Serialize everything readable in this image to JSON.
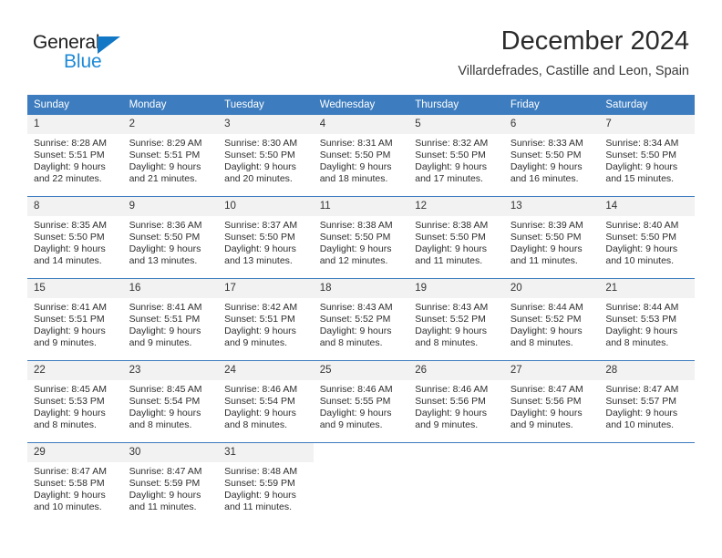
{
  "brand": {
    "name_part1": "General",
    "name_part2": "Blue"
  },
  "header": {
    "title": "December 2024",
    "subtitle": "Villardefrades, Castille and Leon, Spain"
  },
  "colors": {
    "header_blue": "#3c7cbf",
    "logo_blue": "#1e8ad6",
    "daynum_band": "#f2f2f2"
  },
  "calendar": {
    "weekday_headers": [
      "Sunday",
      "Monday",
      "Tuesday",
      "Wednesday",
      "Thursday",
      "Friday",
      "Saturday"
    ],
    "weeks": [
      [
        {
          "day": "1",
          "sunrise": "Sunrise: 8:28 AM",
          "sunset": "Sunset: 5:51 PM",
          "daylight_line1": "Daylight: 9 hours",
          "daylight_line2": "and 22 minutes."
        },
        {
          "day": "2",
          "sunrise": "Sunrise: 8:29 AM",
          "sunset": "Sunset: 5:51 PM",
          "daylight_line1": "Daylight: 9 hours",
          "daylight_line2": "and 21 minutes."
        },
        {
          "day": "3",
          "sunrise": "Sunrise: 8:30 AM",
          "sunset": "Sunset: 5:50 PM",
          "daylight_line1": "Daylight: 9 hours",
          "daylight_line2": "and 20 minutes."
        },
        {
          "day": "4",
          "sunrise": "Sunrise: 8:31 AM",
          "sunset": "Sunset: 5:50 PM",
          "daylight_line1": "Daylight: 9 hours",
          "daylight_line2": "and 18 minutes."
        },
        {
          "day": "5",
          "sunrise": "Sunrise: 8:32 AM",
          "sunset": "Sunset: 5:50 PM",
          "daylight_line1": "Daylight: 9 hours",
          "daylight_line2": "and 17 minutes."
        },
        {
          "day": "6",
          "sunrise": "Sunrise: 8:33 AM",
          "sunset": "Sunset: 5:50 PM",
          "daylight_line1": "Daylight: 9 hours",
          "daylight_line2": "and 16 minutes."
        },
        {
          "day": "7",
          "sunrise": "Sunrise: 8:34 AM",
          "sunset": "Sunset: 5:50 PM",
          "daylight_line1": "Daylight: 9 hours",
          "daylight_line2": "and 15 minutes."
        }
      ],
      [
        {
          "day": "8",
          "sunrise": "Sunrise: 8:35 AM",
          "sunset": "Sunset: 5:50 PM",
          "daylight_line1": "Daylight: 9 hours",
          "daylight_line2": "and 14 minutes."
        },
        {
          "day": "9",
          "sunrise": "Sunrise: 8:36 AM",
          "sunset": "Sunset: 5:50 PM",
          "daylight_line1": "Daylight: 9 hours",
          "daylight_line2": "and 13 minutes."
        },
        {
          "day": "10",
          "sunrise": "Sunrise: 8:37 AM",
          "sunset": "Sunset: 5:50 PM",
          "daylight_line1": "Daylight: 9 hours",
          "daylight_line2": "and 13 minutes."
        },
        {
          "day": "11",
          "sunrise": "Sunrise: 8:38 AM",
          "sunset": "Sunset: 5:50 PM",
          "daylight_line1": "Daylight: 9 hours",
          "daylight_line2": "and 12 minutes."
        },
        {
          "day": "12",
          "sunrise": "Sunrise: 8:38 AM",
          "sunset": "Sunset: 5:50 PM",
          "daylight_line1": "Daylight: 9 hours",
          "daylight_line2": "and 11 minutes."
        },
        {
          "day": "13",
          "sunrise": "Sunrise: 8:39 AM",
          "sunset": "Sunset: 5:50 PM",
          "daylight_line1": "Daylight: 9 hours",
          "daylight_line2": "and 11 minutes."
        },
        {
          "day": "14",
          "sunrise": "Sunrise: 8:40 AM",
          "sunset": "Sunset: 5:50 PM",
          "daylight_line1": "Daylight: 9 hours",
          "daylight_line2": "and 10 minutes."
        }
      ],
      [
        {
          "day": "15",
          "sunrise": "Sunrise: 8:41 AM",
          "sunset": "Sunset: 5:51 PM",
          "daylight_line1": "Daylight: 9 hours",
          "daylight_line2": "and 9 minutes."
        },
        {
          "day": "16",
          "sunrise": "Sunrise: 8:41 AM",
          "sunset": "Sunset: 5:51 PM",
          "daylight_line1": "Daylight: 9 hours",
          "daylight_line2": "and 9 minutes."
        },
        {
          "day": "17",
          "sunrise": "Sunrise: 8:42 AM",
          "sunset": "Sunset: 5:51 PM",
          "daylight_line1": "Daylight: 9 hours",
          "daylight_line2": "and 9 minutes."
        },
        {
          "day": "18",
          "sunrise": "Sunrise: 8:43 AM",
          "sunset": "Sunset: 5:52 PM",
          "daylight_line1": "Daylight: 9 hours",
          "daylight_line2": "and 8 minutes."
        },
        {
          "day": "19",
          "sunrise": "Sunrise: 8:43 AM",
          "sunset": "Sunset: 5:52 PM",
          "daylight_line1": "Daylight: 9 hours",
          "daylight_line2": "and 8 minutes."
        },
        {
          "day": "20",
          "sunrise": "Sunrise: 8:44 AM",
          "sunset": "Sunset: 5:52 PM",
          "daylight_line1": "Daylight: 9 hours",
          "daylight_line2": "and 8 minutes."
        },
        {
          "day": "21",
          "sunrise": "Sunrise: 8:44 AM",
          "sunset": "Sunset: 5:53 PM",
          "daylight_line1": "Daylight: 9 hours",
          "daylight_line2": "and 8 minutes."
        }
      ],
      [
        {
          "day": "22",
          "sunrise": "Sunrise: 8:45 AM",
          "sunset": "Sunset: 5:53 PM",
          "daylight_line1": "Daylight: 9 hours",
          "daylight_line2": "and 8 minutes."
        },
        {
          "day": "23",
          "sunrise": "Sunrise: 8:45 AM",
          "sunset": "Sunset: 5:54 PM",
          "daylight_line1": "Daylight: 9 hours",
          "daylight_line2": "and 8 minutes."
        },
        {
          "day": "24",
          "sunrise": "Sunrise: 8:46 AM",
          "sunset": "Sunset: 5:54 PM",
          "daylight_line1": "Daylight: 9 hours",
          "daylight_line2": "and 8 minutes."
        },
        {
          "day": "25",
          "sunrise": "Sunrise: 8:46 AM",
          "sunset": "Sunset: 5:55 PM",
          "daylight_line1": "Daylight: 9 hours",
          "daylight_line2": "and 9 minutes."
        },
        {
          "day": "26",
          "sunrise": "Sunrise: 8:46 AM",
          "sunset": "Sunset: 5:56 PM",
          "daylight_line1": "Daylight: 9 hours",
          "daylight_line2": "and 9 minutes."
        },
        {
          "day": "27",
          "sunrise": "Sunrise: 8:47 AM",
          "sunset": "Sunset: 5:56 PM",
          "daylight_line1": "Daylight: 9 hours",
          "daylight_line2": "and 9 minutes."
        },
        {
          "day": "28",
          "sunrise": "Sunrise: 8:47 AM",
          "sunset": "Sunset: 5:57 PM",
          "daylight_line1": "Daylight: 9 hours",
          "daylight_line2": "and 10 minutes."
        }
      ],
      [
        {
          "day": "29",
          "sunrise": "Sunrise: 8:47 AM",
          "sunset": "Sunset: 5:58 PM",
          "daylight_line1": "Daylight: 9 hours",
          "daylight_line2": "and 10 minutes."
        },
        {
          "day": "30",
          "sunrise": "Sunrise: 8:47 AM",
          "sunset": "Sunset: 5:59 PM",
          "daylight_line1": "Daylight: 9 hours",
          "daylight_line2": "and 11 minutes."
        },
        {
          "day": "31",
          "sunrise": "Sunrise: 8:48 AM",
          "sunset": "Sunset: 5:59 PM",
          "daylight_line1": "Daylight: 9 hours",
          "daylight_line2": "and 11 minutes."
        },
        {
          "day": "",
          "sunrise": "",
          "sunset": "",
          "daylight_line1": "",
          "daylight_line2": ""
        },
        {
          "day": "",
          "sunrise": "",
          "sunset": "",
          "daylight_line1": "",
          "daylight_line2": ""
        },
        {
          "day": "",
          "sunrise": "",
          "sunset": "",
          "daylight_line1": "",
          "daylight_line2": ""
        },
        {
          "day": "",
          "sunrise": "",
          "sunset": "",
          "daylight_line1": "",
          "daylight_line2": ""
        }
      ]
    ]
  }
}
